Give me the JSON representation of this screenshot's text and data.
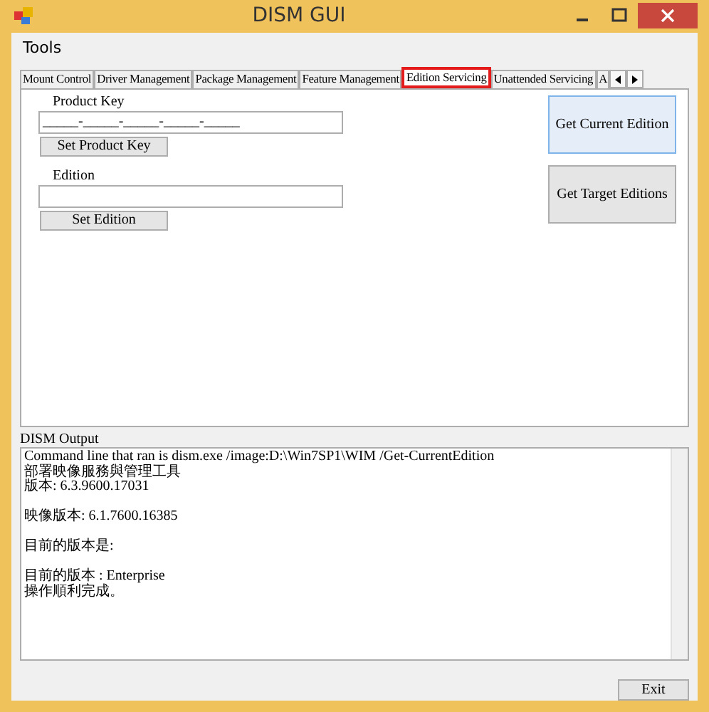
{
  "window": {
    "title": "DISM GUI"
  },
  "menu": [
    "Tools"
  ],
  "tabs": [
    {
      "label": "Mount Control",
      "selected": false
    },
    {
      "label": "Driver Management",
      "selected": false
    },
    {
      "label": "Package Management",
      "selected": false
    },
    {
      "label": "Feature Management",
      "selected": false
    },
    {
      "label": "Edition Servicing",
      "selected": true
    },
    {
      "label": "Unattended Servicing",
      "selected": false
    },
    {
      "label": "A",
      "selected": false
    }
  ],
  "product_key": {
    "label": "Product Key",
    "value": "_____-_____-_____-_____-_____",
    "button": "Set Product Key"
  },
  "edition": {
    "label": "Edition",
    "button": "Set Edition"
  },
  "side_buttons": [
    {
      "label": "Get Current Edition",
      "focused": true
    },
    {
      "label": "Get Target Editions",
      "focused": false
    }
  ],
  "output": {
    "label": "DISM Output",
    "lines": [
      {
        "text": "Command line that ran is dism.exe /image:D:\\Win7SP1\\WIM /Get-CurrentEdition",
        "blank_before": false
      },
      {
        "text": "部署映像服務與管理工具",
        "blank_before": false
      },
      {
        "text": "版本: 6.3.9600.17031",
        "blank_before": false
      },
      {
        "text": "映像版本: 6.1.7600.16385",
        "blank_before": true
      },
      {
        "text": "目前的版本是:",
        "blank_before": true
      },
      {
        "text": "目前的版本 : Enterprise",
        "blank_before": true
      },
      {
        "text": "操作順利完成。",
        "blank_before": false
      }
    ]
  },
  "exit_button": "Exit"
}
